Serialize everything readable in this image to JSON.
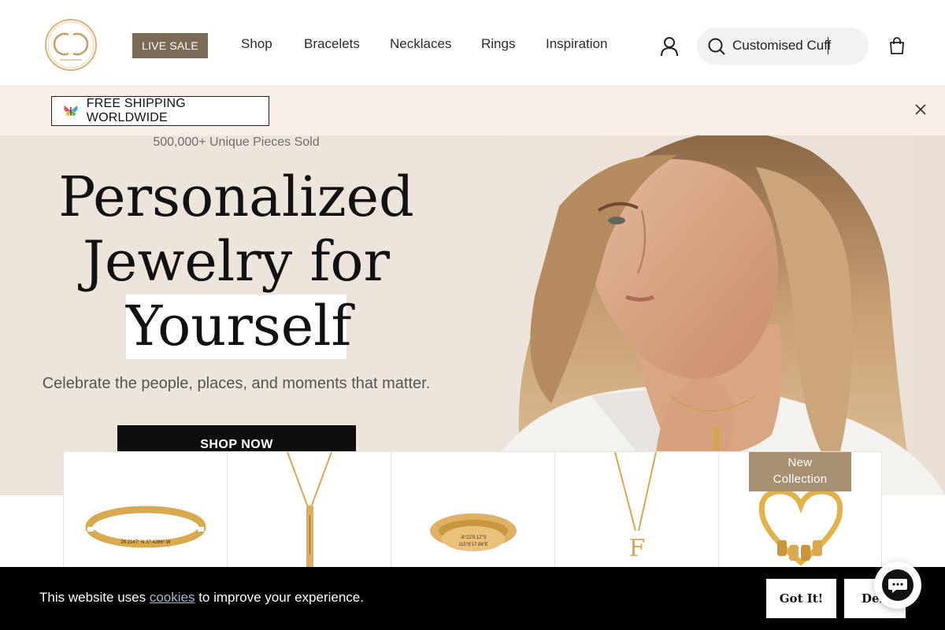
{
  "header": {
    "live_sale": "LIVE SALE",
    "nav": [
      "Shop",
      "Bracelets",
      "Necklaces",
      "Rings",
      "Inspiration"
    ],
    "search_value": "Customised Cuff",
    "logo_icon": "cc-monogram-logo",
    "account_icon": "user-icon",
    "cart_icon": "shopping-bag-icon"
  },
  "announcement": {
    "text": "FREE SHIPPING WORLDWIDE",
    "icon": "butterfly-icon"
  },
  "hero": {
    "sold": "500,000+ Unique Pieces Sold",
    "line1": "Personalized",
    "line2": "Jewelry for",
    "line3": "Yourself",
    "subhead": "Celebrate the people, places, and moments that matter.",
    "cta": "SHOP NOW"
  },
  "products": {
    "badge": "New Collection",
    "badge_line1": "New",
    "badge_line2": "Collection",
    "cuff_coords": "26.2147° N   37.4286° W",
    "ring_line1": "-8°22'9.12\"S",
    "ring_line2": "115°8'17.88\"E",
    "initial": "F"
  },
  "cookie": {
    "prefix": "This website uses ",
    "link": "cookies",
    "suffix": " to improve your experience.",
    "accept": "Got It!",
    "deny": "Deny"
  },
  "colors": {
    "brand_brown": "#7b6a55",
    "badge_tan": "#a89172",
    "hero_bg": "#ede4dc",
    "announce_bg": "#f8efe8",
    "gold": "#d9a94f"
  }
}
